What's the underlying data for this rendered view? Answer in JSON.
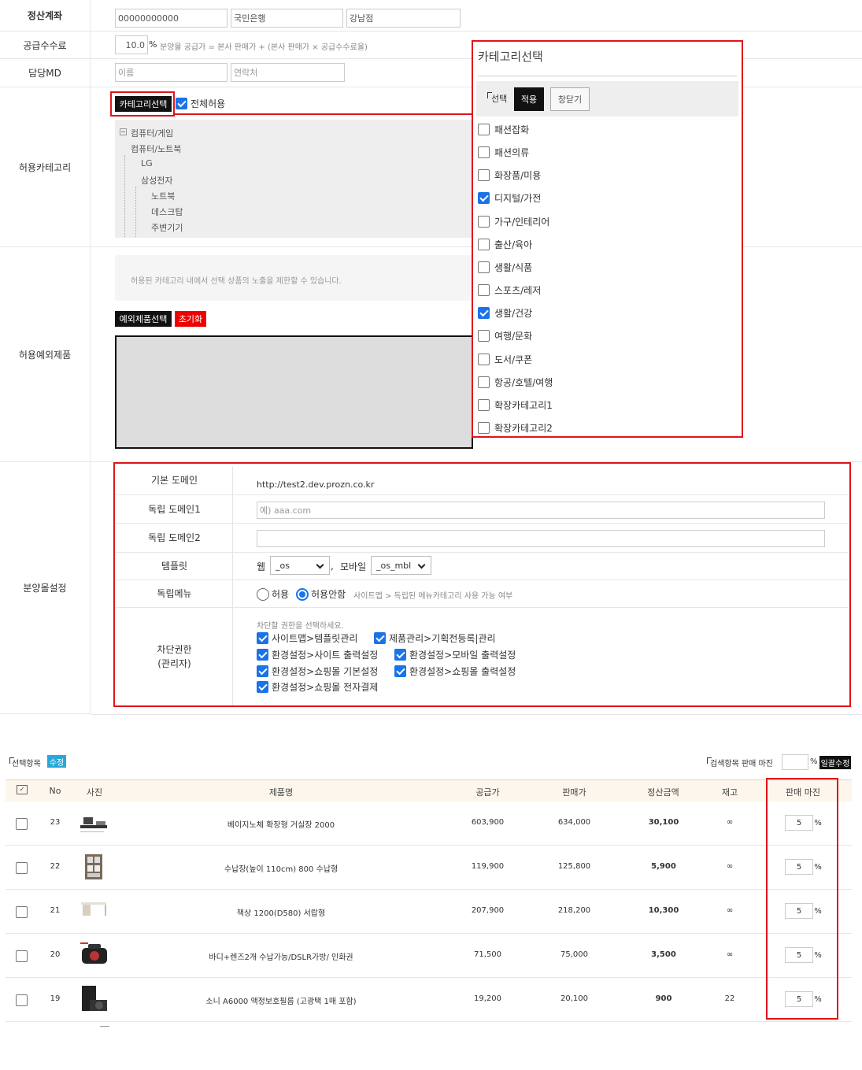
{
  "settlement": {
    "label": "정산계좌",
    "account": "00000000000",
    "bank": "국민은행",
    "branch": "강남점"
  },
  "fee": {
    "label": "공급수수료",
    "value": "10.0",
    "unit": "%",
    "note": "분양몰 공급가 = 본사 판매가 + (본사 판매가 × 공급수수료율)"
  },
  "md": {
    "label": "담당MD",
    "name_placeholder": "이름",
    "contact_placeholder": "연락처"
  },
  "allowed_category": {
    "label": "허용카테고리",
    "select_button": "카테고리선택",
    "allow_all_label": "전체허용",
    "allow_all_checked": true,
    "tree": [
      "컴퓨터/게임",
      "컴퓨터/노트북",
      "LG",
      "삼성전자",
      "노트북",
      "데스크탑",
      "주변기기"
    ]
  },
  "exception": {
    "label": "허용예외제품",
    "notice": "허용된 카테고리 내에서 선택 상품의 노출을 제한할 수 있습니다.",
    "select_button": "예외제품선택",
    "reset_button": "초기화"
  },
  "popup": {
    "title": "카테고리선택",
    "selected_label": "선택",
    "apply_button": "적용",
    "close_button": "창닫기",
    "items": [
      {
        "label": "패션잡화",
        "checked": false
      },
      {
        "label": "패션의류",
        "checked": false
      },
      {
        "label": "화장품/미용",
        "checked": false
      },
      {
        "label": "디지털/가전",
        "checked": true
      },
      {
        "label": "가구/인테리어",
        "checked": false
      },
      {
        "label": "출산/육아",
        "checked": false
      },
      {
        "label": "생활/식품",
        "checked": false
      },
      {
        "label": "스포츠/레저",
        "checked": false
      },
      {
        "label": "생활/건강",
        "checked": true
      },
      {
        "label": "여행/문화",
        "checked": false
      },
      {
        "label": "도서/쿠폰",
        "checked": false
      },
      {
        "label": "항공/호텔/여행",
        "checked": false
      },
      {
        "label": "확장카테고리1",
        "checked": false
      },
      {
        "label": "확장카테고리2",
        "checked": false
      }
    ]
  },
  "mall": {
    "label": "분양몰설정",
    "default_domain_label": "기본 도메인",
    "default_domain": "http://test2.dev.prozn.co.kr",
    "domain1_label": "독립 도메인1",
    "domain1_placeholder": "예) aaa.com",
    "domain2_label": "독립 도메인2",
    "domain2_value": "",
    "template_label": "템플릿",
    "web_label": "웹",
    "web_value": "_os",
    "comma": ",",
    "mobile_label": "모바일",
    "mobile_value": "_os_mbl",
    "menu_label": "독립메뉴",
    "menu_allow": "허용",
    "menu_deny": "허용안함",
    "menu_selected": "deny",
    "menu_note": "사이트맵 > 독립된 메뉴카테고리 사용 가능 여부",
    "perm_label": "차단권한",
    "perm_sublabel": "(관리자)",
    "perm_hint": "차단할 권한을 선택하세요.",
    "perms": [
      "사이트맵>템플릿관리",
      "제품관리>기획전등록|관리",
      "환경설정>사이트 출력설정",
      "환경설정>모바일 출력설정",
      "환경설정>쇼핑몰 기본설정",
      "환경설정>쇼핑몰 출력설정",
      "환경설정>쇼핑몰 전자결제"
    ]
  },
  "products": {
    "selected_label": "선택항목",
    "edit_button": "수정",
    "search_margin_label": "검색항목 판매 마진",
    "percent": "%",
    "bulk_button": "일괄수정",
    "columns": [
      "No",
      "사진",
      "제품명",
      "공급가",
      "판매가",
      "정산금액",
      "재고",
      "판매 마진"
    ],
    "rows": [
      {
        "no": "23",
        "name": "베이지노체 확장형 거실장 2000",
        "supply": "603,900",
        "price": "634,000",
        "settle": "30,100",
        "stock": "∞",
        "margin": "5"
      },
      {
        "no": "22",
        "name": "수납장(높이 110cm) 800 수납형",
        "supply": "119,900",
        "price": "125,800",
        "settle": "5,900",
        "stock": "∞",
        "margin": "5"
      },
      {
        "no": "21",
        "name": "책상 1200(D580) 서랍형",
        "supply": "207,900",
        "price": "218,200",
        "settle": "10,300",
        "stock": "∞",
        "margin": "5"
      },
      {
        "no": "20",
        "name": "바디+렌즈2개 수납가능/DSLR가방/ 인화권",
        "supply": "71,500",
        "price": "75,000",
        "settle": "3,500",
        "stock": "∞",
        "margin": "5"
      },
      {
        "no": "19",
        "name": "소니 A6000 액정보호필름 (고광택 1매 포함)",
        "supply": "19,200",
        "price": "20,100",
        "settle": "900",
        "stock": "22",
        "margin": "5"
      }
    ]
  }
}
